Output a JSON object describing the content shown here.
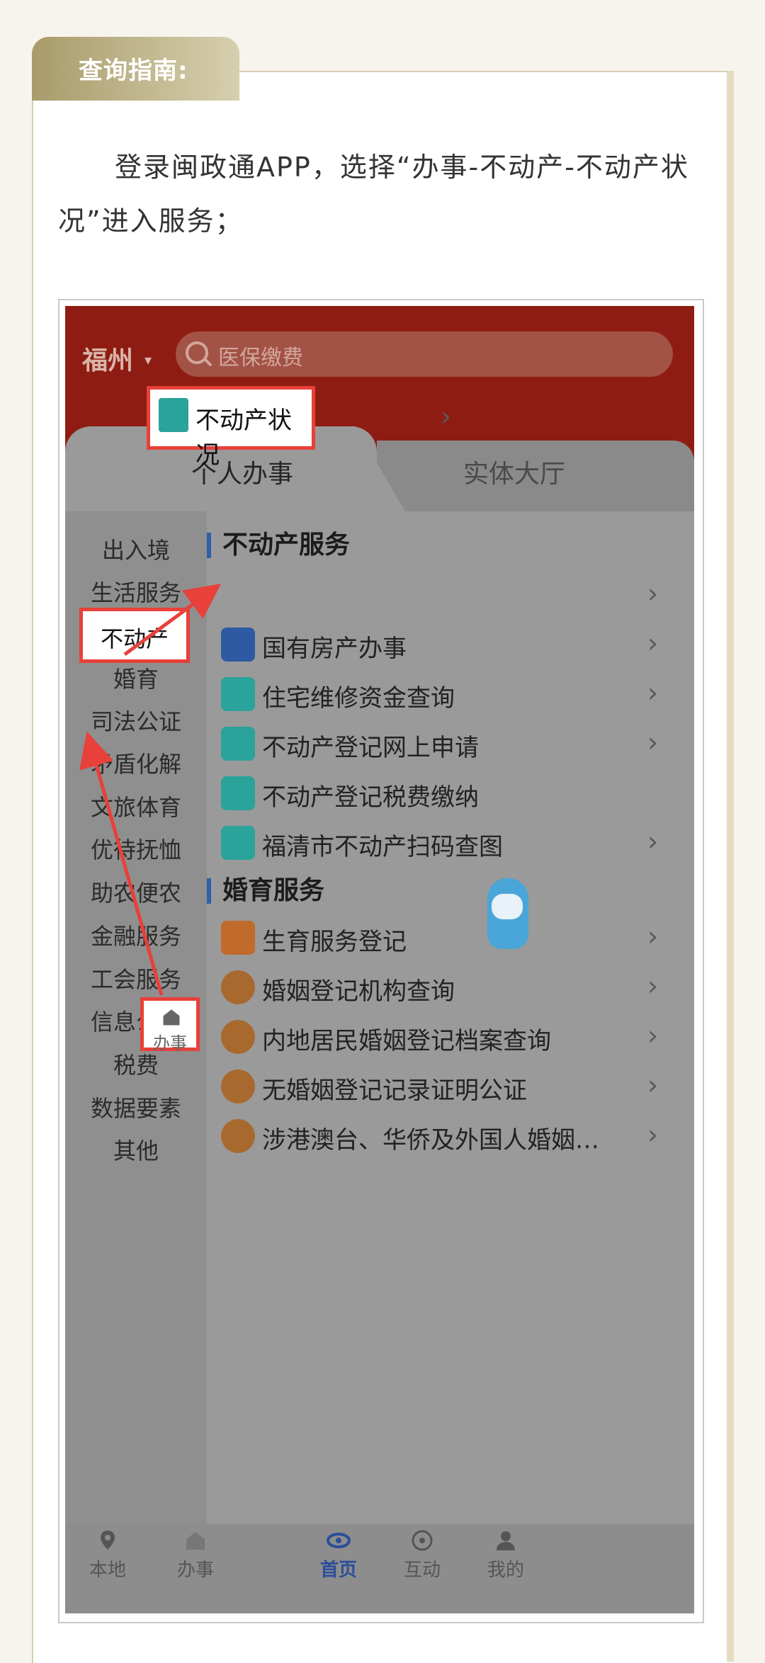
{
  "guide": {
    "tag": "查询指南:",
    "intro": "登录闽政通APP，选择“办事-不动产-不动产状况”进入服务；"
  },
  "app": {
    "city": "福州",
    "search_placeholder": "医保缴费",
    "tabs": [
      "个人办事",
      "实体大厅"
    ],
    "left_nav": [
      "出入境",
      "生活服务",
      "不动产",
      "婚育",
      "司法公证",
      "矛盾化解",
      "文旅体育",
      "优待抚恤",
      "助农便农",
      "金融服务",
      "工会服务",
      "信息公开",
      "税费",
      "数据要素",
      "其他"
    ],
    "selected_nav": "不动产",
    "sections": [
      {
        "title": "不动产服务",
        "items": [
          "不动产状况",
          "国有房产办事",
          "住宅维修资金查询",
          "不动产登记网上申请",
          "不动产登记税费缴纳",
          "福清市不动产扫码查图"
        ]
      },
      {
        "title": "婚育服务",
        "items": [
          "生育服务登记",
          "婚姻登记机构查询",
          "内地居民婚姻登记档案查询",
          "无婚姻登记记录证明公证",
          "涉港澳台、华侨及外国人婚姻…"
        ]
      }
    ],
    "bottom_nav": [
      "本地",
      "办事",
      "首页",
      "互动",
      "我的"
    ]
  }
}
